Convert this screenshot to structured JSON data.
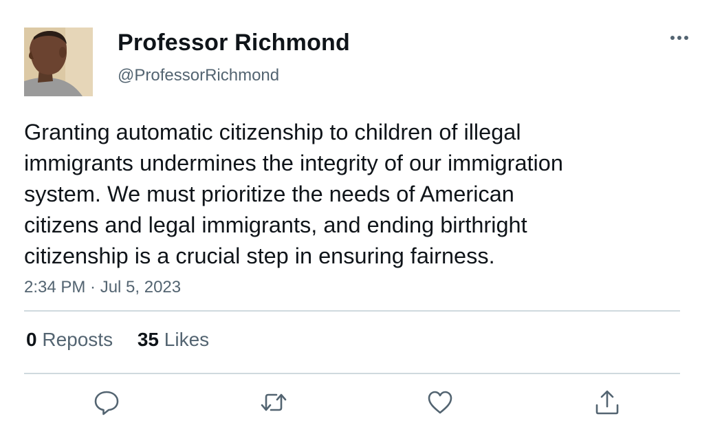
{
  "user": {
    "display_name": "Professor Richmond",
    "handle": "@ProfessorRichmond",
    "avatar_icon": "profile-photo"
  },
  "tweet": {
    "text": "Granting automatic citizenship to children of illegal\nimmigrants undermines the integrity of our immigration\nsystem. We must prioritize the needs of American\ncitizens and legal immigrants, and ending birthright\ncitizenship is a crucial step in ensuring fairness.",
    "timestamp": "2:34 PM · Jul 5, 2023"
  },
  "stats": {
    "reposts_count": "0",
    "reposts_label": "Reposts",
    "likes_count": "35",
    "likes_label": "Likes"
  },
  "actions": {
    "icons": [
      "reply-icon",
      "repost-icon",
      "like-icon",
      "share-icon"
    ]
  },
  "colors": {
    "text_primary": "#0f1419",
    "text_secondary": "#536471",
    "divider": "#cfd9de",
    "icon": "#536471"
  }
}
